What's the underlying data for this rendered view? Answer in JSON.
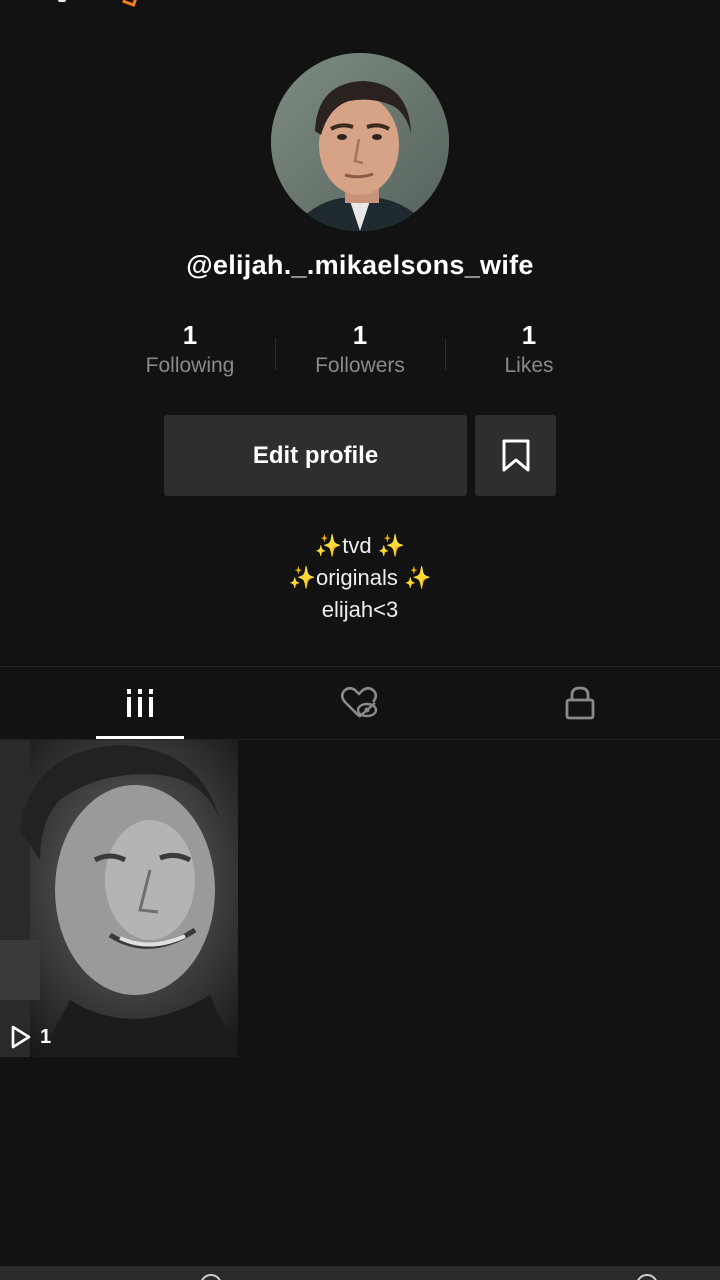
{
  "profile": {
    "username": "@elijah._.mikaelsons_wife",
    "avatar_icon": "profile-avatar"
  },
  "stats": [
    {
      "count": "1",
      "label": "Following"
    },
    {
      "count": "1",
      "label": "Followers"
    },
    {
      "count": "1",
      "label": "Likes"
    }
  ],
  "actions": {
    "edit_profile_label": "Edit profile",
    "bookmark_icon": "bookmark-icon"
  },
  "bio": {
    "line1": "✨tvd ✨",
    "line2": "✨originals ✨",
    "line3": "elijah<3"
  },
  "tabs": [
    {
      "icon": "grid-icon",
      "active": true
    },
    {
      "icon": "liked-hidden-icon",
      "active": false
    },
    {
      "icon": "lock-icon",
      "active": false
    }
  ],
  "videos": [
    {
      "views": "1",
      "icon": "play-icon"
    }
  ],
  "colors": {
    "background": "#121212",
    "button": "#2e2e2e",
    "muted_text": "#8a8a8a",
    "accent_orange": "#ff7a1a"
  }
}
